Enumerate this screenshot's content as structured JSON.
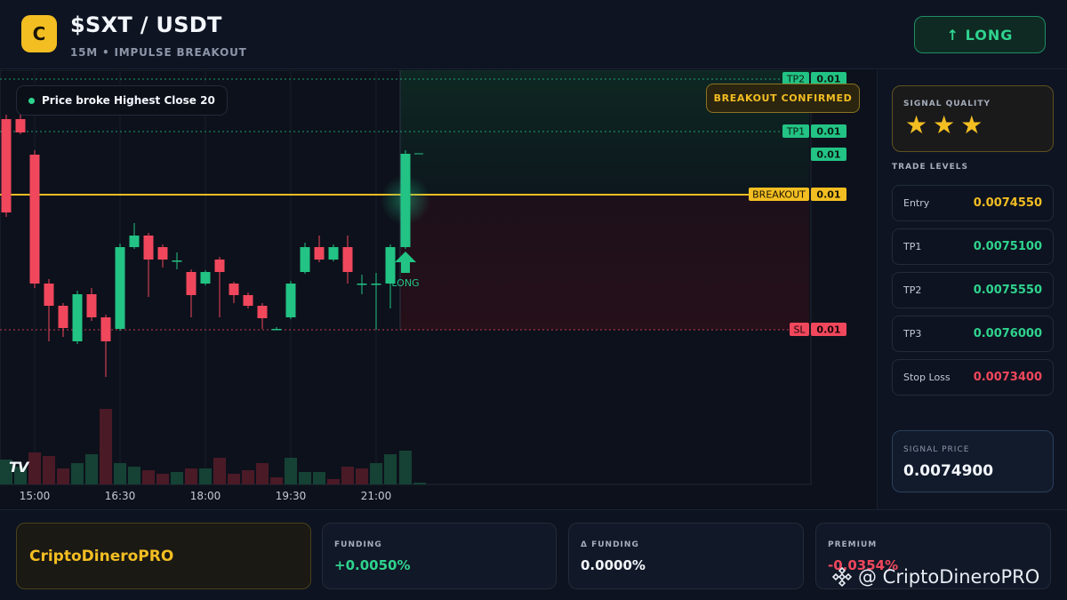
{
  "header": {
    "logo_letter": "C",
    "title": "$SXT / USDT",
    "subtitle": "15M • IMPULSE BREAKOUT",
    "long_button": "↑ LONG"
  },
  "chart": {
    "info_chip": "Price broke Highest Close 20",
    "breakout_badge": "BREAKOUT CONFIRMED",
    "long_marker": "LONG",
    "tv_logo": "TV",
    "time_labels": [
      "15:00",
      "16:30",
      "18:00",
      "19:30",
      "21:00"
    ],
    "level_tags": [
      {
        "label": "TP2",
        "value": "0.01"
      },
      {
        "label": "TP1",
        "value": "0.01"
      },
      {
        "label": "",
        "value": "0.01"
      },
      {
        "label": "BREAKOUT",
        "value": "0.01"
      },
      {
        "label": "SL",
        "value": "0.01"
      }
    ],
    "colors": {
      "up": "#22c384",
      "down": "#f0475c",
      "breakout": "#f3be22"
    }
  },
  "panel": {
    "quality_title": "SIGNAL QUALITY",
    "stars": 3,
    "levels_title": "TRADE LEVELS",
    "levels": [
      {
        "label": "Entry",
        "value": "0.0074550",
        "color": "#f3be22"
      },
      {
        "label": "TP1",
        "value": "0.0075100",
        "color": "#2fd38e"
      },
      {
        "label": "TP2",
        "value": "0.0075550",
        "color": "#2fd38e"
      },
      {
        "label": "TP3",
        "value": "0.0076000",
        "color": "#2fd38e"
      },
      {
        "label": "Stop Loss",
        "value": "0.0073400",
        "color": "#f0475c"
      }
    ],
    "signal_title": "SIGNAL PRICE",
    "signal_value": "0.0074900"
  },
  "footer": {
    "brand": "CriptoDineroPRO",
    "stats": [
      {
        "title": "FUNDING",
        "value": "+0.0050%",
        "color": "#2fd38e"
      },
      {
        "title": "Δ FUNDING",
        "value": "0.0000%",
        "color": "#f3f6fb"
      },
      {
        "title": "PREMIUM",
        "value": "-0.0354%",
        "color": "#f0475c"
      }
    ],
    "watermark": "@ CriptoDineroPRO"
  }
}
